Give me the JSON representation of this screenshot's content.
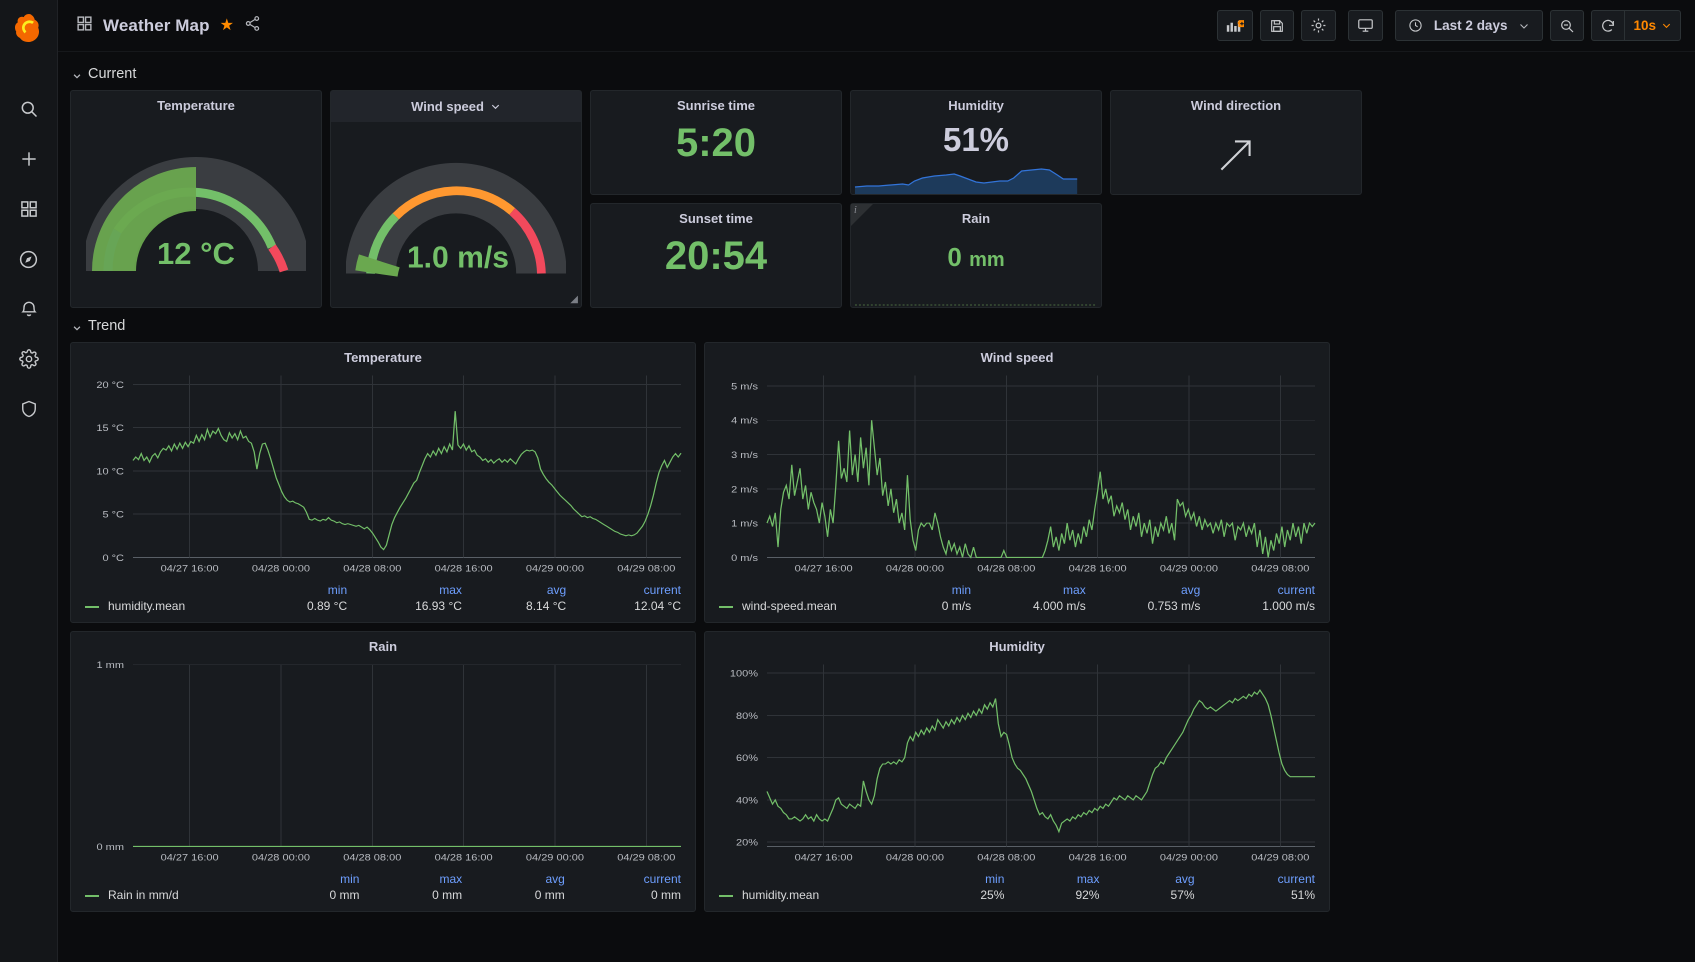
{
  "app": {
    "brand_icon": "grafana-logo-icon",
    "accent": "#ff8800",
    "series_green": "#73bf69",
    "series_blue": "#3274d9",
    "link_blue": "#6e9fff"
  },
  "nav": {
    "items": [
      {
        "name": "search-icon",
        "label": "Search"
      },
      {
        "name": "plus-icon",
        "label": "Create"
      },
      {
        "name": "dashboards-icon",
        "label": "Dashboards"
      },
      {
        "name": "compass-icon",
        "label": "Explore"
      },
      {
        "name": "bell-icon",
        "label": "Alerting"
      },
      {
        "name": "gear-icon",
        "label": "Configuration"
      },
      {
        "name": "shield-icon",
        "label": "Server Admin"
      }
    ]
  },
  "topbar": {
    "dashboard_icon": "dashboard-grid-icon",
    "title": "Weather Map",
    "star_icon": "star-icon",
    "share_icon": "share-icon",
    "buttons": [
      {
        "name": "add-panel-button",
        "icon": "add-panel-icon",
        "label": "Add panel"
      },
      {
        "name": "save-dashboard-button",
        "icon": "save-icon",
        "label": "Save dashboard"
      },
      {
        "name": "dashboard-settings-button",
        "icon": "gear-icon",
        "label": "Dashboard settings"
      },
      {
        "name": "tv-mode-button",
        "icon": "monitor-icon",
        "label": "Cycle view mode"
      }
    ],
    "time_picker": {
      "icon": "clock-icon",
      "label": "Last 2 days",
      "chevron": "chevron-down-icon"
    },
    "zoom_out": {
      "icon": "zoom-out-icon",
      "label": "Zoom out time range"
    },
    "refresh": {
      "icon": "refresh-icon",
      "interval": "10s",
      "chevron": "chevron-down-icon"
    }
  },
  "rows": [
    {
      "name": "row-current",
      "label": "Current",
      "collapsed": false
    },
    {
      "name": "row-trend",
      "label": "Trend",
      "collapsed": false
    }
  ],
  "current": {
    "temperature": {
      "title": "Temperature",
      "value": "12 °C",
      "gauge": {
        "min": -20,
        "max": 40,
        "value": 12,
        "thresholds": [
          {
            "at": -20,
            "color": "#3274d9"
          },
          {
            "at": -5,
            "color": "#73bf69"
          },
          {
            "at": 33,
            "color": "#f2495c"
          }
        ]
      }
    },
    "wind_speed": {
      "title": "Wind speed",
      "menu_icon": "chevron-down-icon",
      "value": "1.0 m/s",
      "gauge": {
        "min": 0,
        "max": 20,
        "value": 1.0,
        "thresholds": [
          {
            "at": 0,
            "color": "#73bf69"
          },
          {
            "at": 7,
            "color": "#ff9830"
          },
          {
            "at": 14,
            "color": "#f2495c"
          }
        ]
      }
    },
    "sunrise": {
      "title": "Sunrise time",
      "value": "5:20"
    },
    "sunset": {
      "title": "Sunset time",
      "value": "20:54"
    },
    "humidity": {
      "title": "Humidity",
      "value": "51%"
    },
    "rain": {
      "title": "Rain",
      "value": "0",
      "unit": "mm",
      "info_badge": "i"
    },
    "wind_direction": {
      "title": "Wind direction",
      "arrow_icon": "arrow-up-right-icon",
      "direction_deg": 45
    }
  },
  "chart_data": [
    {
      "name": "temperature-trend",
      "type": "line",
      "title": "Temperature",
      "ylabel": "",
      "xlabel": "",
      "unit": "°C",
      "ylim": [
        0,
        21
      ],
      "yticks": [
        0,
        5,
        10,
        15,
        20
      ],
      "yticklabels": [
        "0 °C",
        "5 °C",
        "10 °C",
        "15 °C",
        "20 °C"
      ],
      "xticklabels": [
        "04/27 16:00",
        "04/28 00:00",
        "04/28 08:00",
        "04/28 16:00",
        "04/29 00:00",
        "04/29 08:00"
      ],
      "grid": true,
      "legend": {
        "position": "bottom",
        "columns": [
          "min",
          "max",
          "avg",
          "current"
        ],
        "series": [
          {
            "name": "humidity.mean",
            "color": "#73bf69",
            "min": "0.89 °C",
            "max": "16.93 °C",
            "avg": "8.14 °C",
            "current": "12.04 °C"
          }
        ]
      },
      "values": [
        11.2,
        11.6,
        11.3,
        12.0,
        11.2,
        11.6,
        11.0,
        11.7,
        12.0,
        11.5,
        12.2,
        12.6,
        12.4,
        12.9,
        12.3,
        13.1,
        12.5,
        13.2,
        12.6,
        13.3,
        12.8,
        13.4,
        13.2,
        14.1,
        13.4,
        14.2,
        13.6,
        14.8,
        13.9,
        14.6,
        14.3,
        14.9,
        14.1,
        13.6,
        13.4,
        14.4,
        13.8,
        14.3,
        13.6,
        14.6,
        13.8,
        14.0,
        13.4,
        13.2,
        12.2,
        10.2,
        12.0,
        13.1,
        13.2,
        12.4,
        11.4,
        10.3,
        9.2,
        8.4,
        7.6,
        7.0,
        6.6,
        6.4,
        6.5,
        6.3,
        6.2,
        6.0,
        5.8,
        5.2,
        4.4,
        4.3,
        4.5,
        4.3,
        4.2,
        4.4,
        4.3,
        4.6,
        4.3,
        4.2,
        4.0,
        4.1,
        3.9,
        3.8,
        3.9,
        3.8,
        3.7,
        3.6,
        3.7,
        3.5,
        3.3,
        3.5,
        3.2,
        2.8,
        2.3,
        1.8,
        1.2,
        0.9,
        1.4,
        2.6,
        3.8,
        4.6,
        5.2,
        5.8,
        6.3,
        6.8,
        7.4,
        8.0,
        8.6,
        8.9,
        9.8,
        10.6,
        11.4,
        12.0,
        11.6,
        12.3,
        11.8,
        12.6,
        12.0,
        12.8,
        12.2,
        13.1,
        12.4,
        16.9,
        13.0,
        12.6,
        13.1,
        12.4,
        12.9,
        12.2,
        12.4,
        11.8,
        11.6,
        11.2,
        11.4,
        11.0,
        11.3,
        10.9,
        11.2,
        11.4,
        11.0,
        11.3,
        11.0,
        11.4,
        11.1,
        10.8,
        11.4,
        11.9,
        12.2,
        12.4,
        12.3,
        12.4,
        12.2,
        11.5,
        10.2,
        9.6,
        9.1,
        8.7,
        8.4,
        8.0,
        7.6,
        7.2,
        6.9,
        6.6,
        6.3,
        6.0,
        5.6,
        5.3,
        5.0,
        4.7,
        4.8,
        4.6,
        4.7,
        4.5,
        4.4,
        4.2,
        4.0,
        3.8,
        3.6,
        3.4,
        3.2,
        3.0,
        2.9,
        2.7,
        2.6,
        2.5,
        2.6,
        2.5,
        2.6,
        2.8,
        3.2,
        3.6,
        4.2,
        5.0,
        6.0,
        7.2,
        8.6,
        9.8,
        10.6,
        11.2,
        10.4,
        11.0,
        11.6,
        12.0,
        11.6,
        12.04
      ]
    },
    {
      "name": "wind-speed-trend",
      "type": "line",
      "title": "Wind speed",
      "unit": "m/s",
      "ylim": [
        0,
        5.3
      ],
      "yticks": [
        0,
        1,
        2,
        3,
        4,
        5
      ],
      "yticklabels": [
        "0 m/s",
        "1 m/s",
        "2 m/s",
        "3 m/s",
        "4 m/s",
        "5 m/s"
      ],
      "xticklabels": [
        "04/27 16:00",
        "04/28 00:00",
        "04/28 08:00",
        "04/28 16:00",
        "04/29 00:00",
        "04/29 08:00"
      ],
      "grid": true,
      "legend": {
        "position": "bottom",
        "columns": [
          "min",
          "max",
          "avg",
          "current"
        ],
        "series": [
          {
            "name": "wind-speed.mean",
            "color": "#73bf69",
            "min": "0 m/s",
            "max": "4.000 m/s",
            "avg": "0.753 m/s",
            "current": "1.000 m/s"
          }
        ]
      },
      "values": [
        1.0,
        1.2,
        0.9,
        1.3,
        0.3,
        1.4,
        1.9,
        2.1,
        1.7,
        2.7,
        1.8,
        2.2,
        2.6,
        1.7,
        2.1,
        1.4,
        1.9,
        1.6,
        1.4,
        1.0,
        1.6,
        1.2,
        0.6,
        1.4,
        1.0,
        2.1,
        3.4,
        2.3,
        2.6,
        2.2,
        3.7,
        2.4,
        3.0,
        2.2,
        3.5,
        2.6,
        3.2,
        2.1,
        4.0,
        3.2,
        2.4,
        2.9,
        1.8,
        2.2,
        1.5,
        2.0,
        1.3,
        1.7,
        1.0,
        1.3,
        0.8,
        2.4,
        1.1,
        0.5,
        0.2,
        0.8,
        1.0,
        0.9,
        1.0,
        1.0,
        0.8,
        1.3,
        1.0,
        0.6,
        0.3,
        0.1,
        0.5,
        0.2,
        0.4,
        0.1,
        0.3,
        0.0,
        0.4,
        0.1,
        0.0,
        0.3,
        0.0,
        0.0,
        0.0,
        0.0,
        0.0,
        0.0,
        0.0,
        0.0,
        0.0,
        0.0,
        0.2,
        0.0,
        0.0,
        0.0,
        0.0,
        0.0,
        0.0,
        0.0,
        0.0,
        0.0,
        0.0,
        0.0,
        0.0,
        0.0,
        0.0,
        0.2,
        0.5,
        0.9,
        0.3,
        0.6,
        0.2,
        0.7,
        0.4,
        1.0,
        0.5,
        0.8,
        0.3,
        0.7,
        0.4,
        0.9,
        0.6,
        1.1,
        0.8,
        1.4,
        1.9,
        2.5,
        1.7,
        2.0,
        1.6,
        1.8,
        1.2,
        1.5,
        1.3,
        1.6,
        1.1,
        1.4,
        0.8,
        1.2,
        0.9,
        1.3,
        0.6,
        1.0,
        0.7,
        1.1,
        0.4,
        0.9,
        0.6,
        1.0,
        0.8,
        1.2,
        0.7,
        1.0,
        0.5,
        1.7,
        1.5,
        1.6,
        1.2,
        1.4,
        1.1,
        1.3,
        0.9,
        1.2,
        0.8,
        1.1,
        0.9,
        1.0,
        0.7,
        1.0,
        0.8,
        1.1,
        0.6,
        1.0,
        0.9,
        1.0,
        0.5,
        0.9,
        0.8,
        1.0,
        0.6,
        0.9,
        0.7,
        1.0,
        0.3,
        0.8,
        0.1,
        0.6,
        0.0,
        0.5,
        0.2,
        0.7,
        0.4,
        0.9,
        0.3,
        0.8,
        0.5,
        1.0,
        0.6,
        0.9,
        0.4,
        1.0,
        0.7,
        1.0,
        0.9,
        1.0
      ]
    },
    {
      "name": "rain-trend",
      "type": "line",
      "title": "Rain",
      "unit": "mm",
      "ylim": [
        0,
        1
      ],
      "yticks": [
        0,
        1
      ],
      "yticklabels": [
        "0 mm",
        "1 mm"
      ],
      "xticklabels": [
        "04/27 16:00",
        "04/28 00:00",
        "04/28 08:00",
        "04/28 16:00",
        "04/29 00:00",
        "04/29 08:00"
      ],
      "grid": true,
      "legend": {
        "position": "bottom",
        "columns": [
          "min",
          "max",
          "avg",
          "current"
        ],
        "series": [
          {
            "name": "Rain in mm/d",
            "color": "#73bf69",
            "min": "0 mm",
            "max": "0 mm",
            "avg": "0 mm",
            "current": "0 mm"
          }
        ]
      },
      "values": [
        0,
        0,
        0,
        0,
        0,
        0,
        0,
        0,
        0,
        0,
        0,
        0,
        0,
        0,
        0,
        0,
        0,
        0,
        0,
        0,
        0,
        0,
        0,
        0,
        0,
        0,
        0,
        0,
        0,
        0,
        0,
        0,
        0,
        0,
        0,
        0,
        0,
        0,
        0,
        0
      ]
    },
    {
      "name": "humidity-trend",
      "type": "line",
      "title": "Humidity",
      "unit": "%",
      "ylim": [
        18,
        104
      ],
      "yticks": [
        20,
        40,
        60,
        80,
        100
      ],
      "yticklabels": [
        "20%",
        "40%",
        "60%",
        "80%",
        "100%"
      ],
      "xticklabels": [
        "04/27 16:00",
        "04/28 00:00",
        "04/28 08:00",
        "04/28 16:00",
        "04/29 00:00",
        "04/29 08:00"
      ],
      "grid": true,
      "legend": {
        "position": "bottom",
        "columns": [
          "min",
          "max",
          "avg",
          "current"
        ],
        "series": [
          {
            "name": "humidity.mean",
            "color": "#73bf69",
            "min": "25%",
            "max": "92%",
            "avg": "57%",
            "current": "51%"
          }
        ]
      },
      "values": [
        44,
        41,
        38,
        40,
        37,
        36,
        34,
        33,
        31,
        31,
        32,
        31,
        30,
        31,
        33,
        31,
        32,
        30,
        33,
        31,
        30,
        31,
        30,
        33,
        36,
        40,
        41,
        38,
        37,
        36,
        38,
        37,
        36,
        38,
        37,
        49,
        44,
        40,
        38,
        42,
        50,
        55,
        57,
        57,
        58,
        57,
        58,
        57,
        59,
        58,
        60,
        67,
        70,
        68,
        72,
        70,
        73,
        71,
        74,
        72,
        75,
        73,
        78,
        76,
        74,
        77,
        75,
        78,
        76,
        79,
        77,
        80,
        78,
        81,
        79,
        82,
        80,
        83,
        81,
        85,
        83,
        86,
        84,
        88,
        76,
        70,
        72,
        71,
        66,
        60,
        57,
        55,
        54,
        52,
        50,
        47,
        44,
        40,
        36,
        33,
        34,
        32,
        31,
        33,
        30,
        28,
        25,
        29,
        30,
        31,
        30,
        32,
        31,
        33,
        32,
        34,
        33,
        35,
        34,
        36,
        35,
        37,
        36,
        38,
        37,
        39,
        41,
        40,
        42,
        41,
        40,
        42,
        41,
        40,
        42,
        41,
        40,
        42,
        44,
        48,
        52,
        55,
        56,
        58,
        57,
        60,
        62,
        64,
        66,
        68,
        70,
        72,
        75,
        78,
        80,
        83,
        85,
        87,
        86,
        84,
        83,
        84,
        83,
        82,
        83,
        84,
        85,
        86,
        87,
        86,
        88,
        87,
        88,
        89,
        88,
        90,
        89,
        91,
        90,
        92,
        90,
        88,
        85,
        80,
        74,
        68,
        62,
        57,
        54,
        52,
        51,
        51,
        51,
        51,
        51,
        51,
        51,
        51,
        51,
        51
      ]
    }
  ]
}
